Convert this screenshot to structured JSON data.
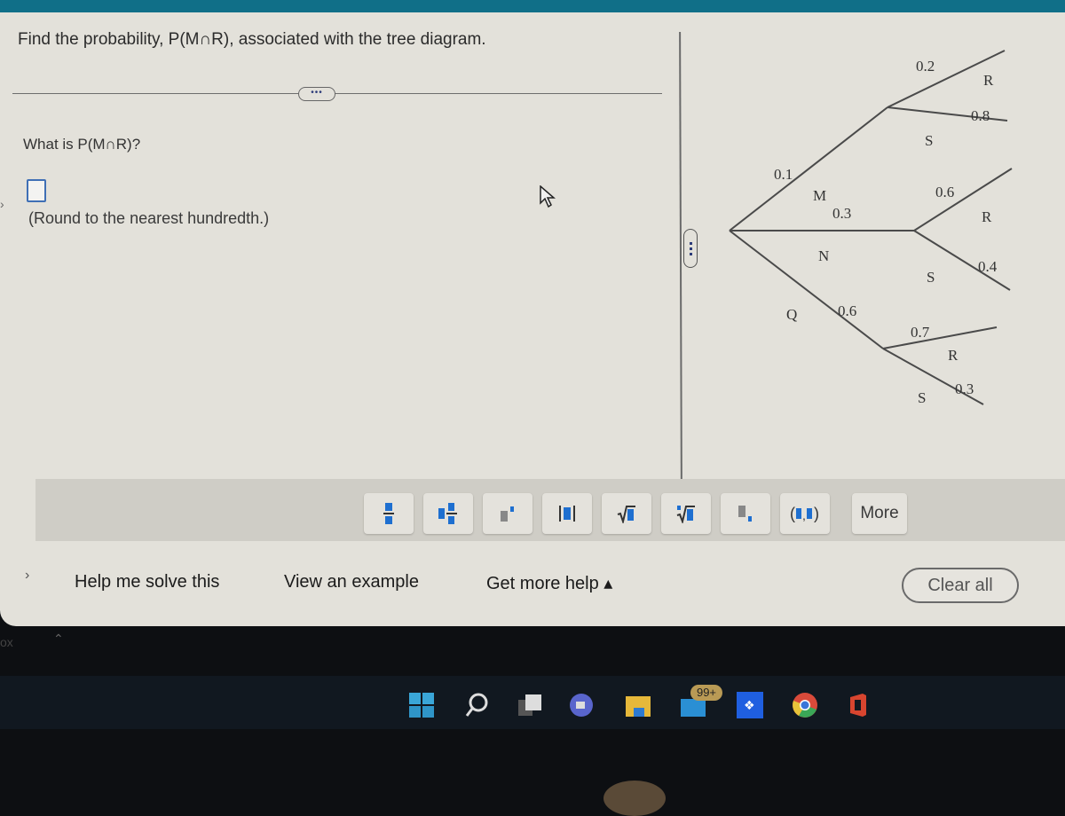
{
  "question": {
    "prompt": "Find the probability, P(M∩R), associated with the tree diagram.",
    "expand_dots": "•••",
    "ask": "What is P(M∩R)?",
    "answer_value": "",
    "hint": "(Round to the nearest hundredth.)"
  },
  "tree_diagram": {
    "first_level": [
      {
        "label": "M",
        "prob": "0.1"
      },
      {
        "label": "N",
        "prob": "0.3"
      },
      {
        "label": "Q",
        "prob": "0.6"
      }
    ],
    "second_level": [
      {
        "parent": "M",
        "branches": [
          {
            "label": "R",
            "prob": "0.2"
          },
          {
            "label": "S",
            "prob": "0.8"
          }
        ]
      },
      {
        "parent": "N",
        "branches": [
          {
            "label": "R",
            "prob": "0.6"
          },
          {
            "label": "S",
            "prob": "0.4"
          }
        ]
      },
      {
        "parent": "Q",
        "branches": [
          {
            "label": "R",
            "prob": "0.7"
          },
          {
            "label": "S",
            "prob": "0.3"
          }
        ]
      }
    ]
  },
  "toolbar": {
    "buttons": [
      {
        "name": "fraction"
      },
      {
        "name": "mixed-number"
      },
      {
        "name": "exponent"
      },
      {
        "name": "absolute-value"
      },
      {
        "name": "square-root"
      },
      {
        "name": "nth-root"
      },
      {
        "name": "subscript"
      },
      {
        "name": "ordered-pair",
        "label": "(▮,▮)"
      },
      {
        "name": "more",
        "label": "More"
      }
    ]
  },
  "footer": {
    "help_me_solve": "Help me solve this",
    "view_example": "View an example",
    "get_more_help": "Get more help ▴",
    "clear_all": "Clear all"
  },
  "taskbar": {
    "mail_badge": "99+",
    "left_text": "ox"
  },
  "colors": {
    "accent": "#3f6fb5",
    "top_bar": "#106f88",
    "panel_bg": "#e3e1da"
  }
}
